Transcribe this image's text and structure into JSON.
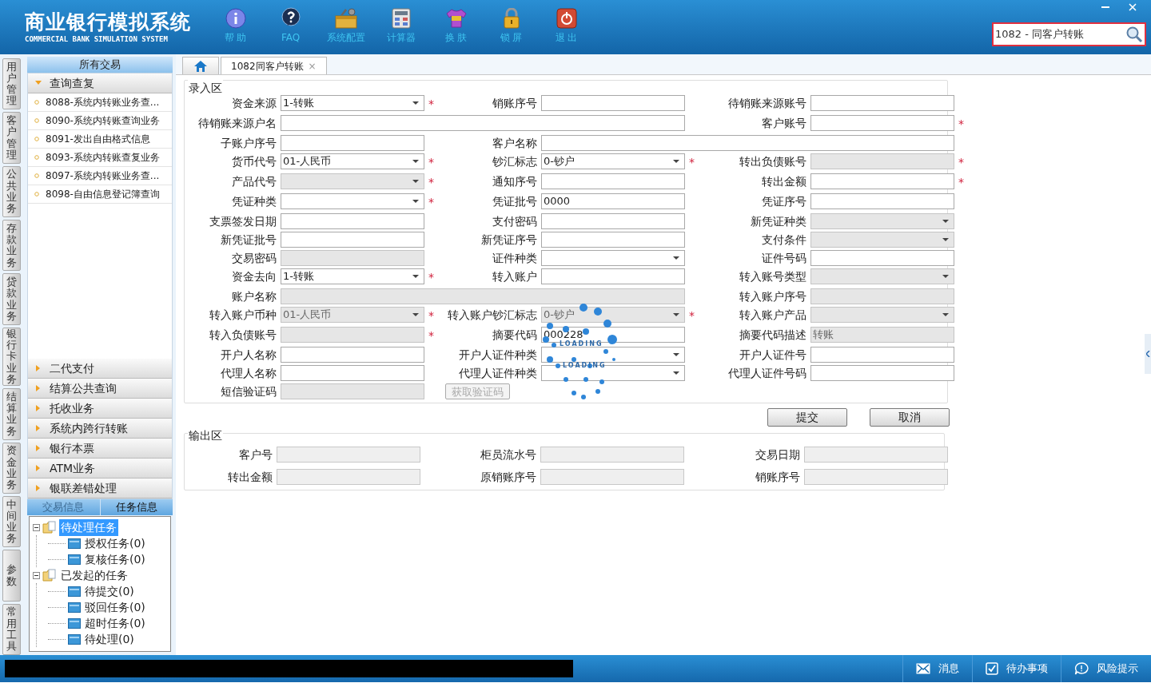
{
  "header": {
    "title": "商业银行模拟系统",
    "subtitle": "COMMERCIAL BANK SIMULATION SYSTEM",
    "toolbar": [
      {
        "kind": "info",
        "label": "帮 助"
      },
      {
        "kind": "faq",
        "label": "FAQ"
      },
      {
        "kind": "config",
        "label": "系统配置"
      },
      {
        "kind": "calculator",
        "label": "计算器"
      },
      {
        "kind": "skin",
        "label": "换 肤"
      },
      {
        "kind": "lock",
        "label": "锁 屏"
      },
      {
        "kind": "exit",
        "label": "退 出"
      }
    ],
    "search": {
      "value": "1082 - 同客户转账"
    }
  },
  "side_tabs": [
    "用户管理",
    "客户管理",
    "公共业务",
    "存款业务",
    "贷款业务",
    "银行卡业务",
    "结算业务",
    "资金业务",
    "中间业务",
    "参数",
    "常用工具"
  ],
  "sidebar": {
    "title": "所有交易",
    "sections": [
      {
        "label": "查询查复",
        "expanded": true,
        "items": [
          "8088-系统内转账业务查...",
          "8090-系统内转账查询业务",
          "8091-发出自由格式信息",
          "8093-系统内转账查复业务",
          "8097-系统内转账业务查...",
          "8098-自由信息登记簿查询"
        ]
      },
      {
        "label": "二代支付",
        "expanded": false
      },
      {
        "label": "结算公共查询",
        "expanded": false
      },
      {
        "label": "托收业务",
        "expanded": false
      },
      {
        "label": "系统内跨行转账",
        "expanded": false
      },
      {
        "label": "银行本票",
        "expanded": false
      },
      {
        "label": "ATM业务",
        "expanded": false
      },
      {
        "label": "银联差错处理",
        "expanded": false
      }
    ],
    "info_tabs": [
      {
        "label": "交易信息",
        "selected": false
      },
      {
        "label": "任务信息",
        "selected": true
      }
    ],
    "tree": [
      {
        "label": "待处理任务",
        "selected": true,
        "expanded": true,
        "children": [
          {
            "label": "授权任务(0)",
            "selected": false
          },
          {
            "label": "复核任务(0)",
            "selected": false
          }
        ]
      },
      {
        "label": "已发起的任务",
        "selected": false,
        "expanded": true,
        "children": [
          {
            "label": "待提交(0)",
            "selected": false
          },
          {
            "label": "驳回任务(0)",
            "selected": false
          },
          {
            "label": "超时任务(0)",
            "selected": false
          },
          {
            "label": "待处理(0)",
            "selected": false
          }
        ]
      }
    ]
  },
  "tabs": [
    {
      "kind": "home",
      "selected": false
    },
    {
      "kind": "page",
      "label": "1082同客户转账",
      "close": "×",
      "selected": true
    }
  ],
  "input_area": {
    "title": "录入区",
    "rows": [
      [
        {
          "kind": "select",
          "label": "资金来源",
          "value": "1-转账",
          "required_mark": "*",
          "disabled": false,
          "wide": false
        },
        {
          "kind": "text",
          "label": "销账序号",
          "disabled": false,
          "wide": false
        },
        {
          "kind": "text",
          "label": "待销账来源账号",
          "disabled": false,
          "wide": false
        }
      ],
      [
        {
          "kind": "text",
          "label": "待销账来源户名",
          "disabled": false,
          "wide": true
        },
        {
          "kind": "text",
          "label": "客户账号",
          "required_mark": "*",
          "disabled": false,
          "wide": false
        }
      ],
      [
        {
          "kind": "text",
          "label": "子账户序号",
          "disabled": false,
          "wide": false
        },
        {
          "kind": "text",
          "label": "客户名称",
          "disabled": false,
          "wide": true
        }
      ],
      [
        {
          "kind": "select",
          "label": "货币代号",
          "value": "01-人民币",
          "required_mark": "*",
          "disabled": false,
          "wide": false
        },
        {
          "kind": "select",
          "label": "钞汇标志",
          "value": "0-钞户",
          "required_mark": "*",
          "disabled": false,
          "wide": false
        },
        {
          "kind": "text",
          "label": "转出负债账号",
          "required_mark": "*",
          "disabled": true,
          "wide": false
        }
      ],
      [
        {
          "kind": "select",
          "label": "产品代号",
          "required_mark": "*",
          "disabled": true,
          "wide": false
        },
        {
          "kind": "text",
          "label": "通知序号",
          "disabled": false,
          "wide": false
        },
        {
          "kind": "text",
          "label": "转出金额",
          "required_mark": "*",
          "disabled": false,
          "wide": false
        }
      ],
      [
        {
          "kind": "select",
          "label": "凭证种类",
          "required_mark": "*",
          "disabled": false,
          "wide": false
        },
        {
          "kind": "text",
          "label": "凭证批号",
          "value": "0000",
          "disabled": false,
          "wide": false
        },
        {
          "kind": "text",
          "label": "凭证序号",
          "disabled": false,
          "wide": false
        }
      ],
      [
        {
          "kind": "text",
          "label": "支票签发日期",
          "disabled": false,
          "wide": false
        },
        {
          "kind": "text",
          "label": "支付密码",
          "disabled": false,
          "wide": false
        },
        {
          "kind": "select",
          "label": "新凭证种类",
          "disabled": true,
          "wide": false
        }
      ],
      [
        {
          "kind": "text",
          "label": "新凭证批号",
          "disabled": false,
          "wide": false
        },
        {
          "kind": "text",
          "label": "新凭证序号",
          "disabled": false,
          "wide": false
        },
        {
          "kind": "select",
          "label": "支付条件",
          "disabled": true,
          "wide": false
        }
      ],
      [
        {
          "kind": "text",
          "label": "交易密码",
          "disabled": true,
          "wide": false
        },
        {
          "kind": "select",
          "label": "证件种类",
          "disabled": false,
          "wide": false
        },
        {
          "kind": "text",
          "label": "证件号码",
          "disabled": false,
          "wide": false
        }
      ],
      [
        {
          "kind": "select",
          "label": "资金去向",
          "value": "1-转账",
          "required_mark": "*",
          "disabled": false,
          "wide": false
        },
        {
          "kind": "text",
          "label": "转入账户",
          "disabled": false,
          "wide": false
        },
        {
          "kind": "select",
          "label": "转入账号类型",
          "disabled": true,
          "wide": false
        }
      ],
      [
        {
          "kind": "text",
          "label": "账户名称",
          "disabled": true,
          "wide": true
        },
        {
          "kind": "text",
          "label": "转入账户序号",
          "disabled": true,
          "wide": false
        }
      ],
      [
        {
          "kind": "select",
          "label": "转入账户币种",
          "value": "01-人民币",
          "required_mark": "*",
          "disabled": true,
          "wide": false
        },
        {
          "kind": "select",
          "label": "转入账户钞汇标志",
          "value": "0-钞户",
          "required_mark": "*",
          "disabled": true,
          "wide": false
        },
        {
          "kind": "select",
          "label": "转入账户产品",
          "disabled": true,
          "wide": false
        }
      ],
      [
        {
          "kind": "text",
          "label": "转入负债账号",
          "required_mark": "*",
          "disabled": true,
          "wide": false
        },
        {
          "kind": "text",
          "label": "摘要代码",
          "value": "000228",
          "disabled": false,
          "wide": false
        },
        {
          "kind": "text",
          "label": "摘要代码描述",
          "value": "转账",
          "disabled": true,
          "wide": false
        }
      ],
      [
        {
          "kind": "text",
          "label": "开户人名称",
          "disabled": false,
          "wide": false
        },
        {
          "kind": "select",
          "label": "开户人证件种类",
          "disabled": false,
          "wide": false
        },
        {
          "kind": "text",
          "label": "开户人证件号",
          "disabled": false,
          "wide": false
        }
      ],
      [
        {
          "kind": "text",
          "label": "代理人名称",
          "disabled": false,
          "wide": false
        },
        {
          "kind": "select",
          "label": "代理人证件种类",
          "disabled": false,
          "wide": false
        },
        {
          "kind": "text",
          "label": "代理人证件号码",
          "disabled": false,
          "wide": false
        }
      ],
      [
        {
          "kind": "text",
          "label": "短信验证码",
          "disabled": true,
          "wide": false
        },
        {
          "kind": "action",
          "label": "获取验证码",
          "disabled": true
        }
      ]
    ]
  },
  "loading": [
    "LOADING",
    "LOADING"
  ],
  "actions": [
    "提交",
    "取消"
  ],
  "output_area": {
    "title": "输出区",
    "fields": [
      "客户号",
      "柜员流水号",
      "交易日期",
      "转出金额",
      "原销账序号",
      "销账序号"
    ]
  },
  "status_bar": [
    {
      "kind": "message",
      "label": "消息"
    },
    {
      "kind": "todo",
      "label": "待办事项"
    },
    {
      "kind": "risk",
      "label": "风险提示"
    }
  ]
}
